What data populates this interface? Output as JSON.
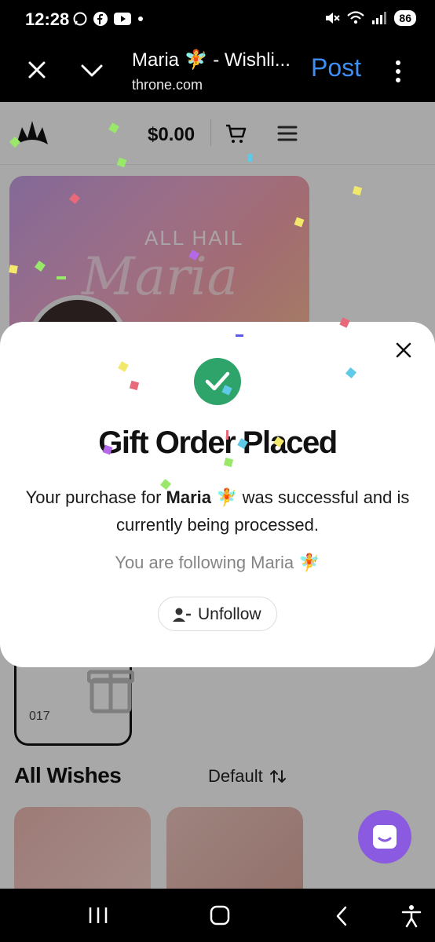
{
  "status_bar": {
    "time": "12:28",
    "battery": "86",
    "left_icons": [
      "chat-bubble-icon",
      "facebook-icon",
      "youtube-icon",
      "dot-icon"
    ],
    "right_icons": [
      "mute-icon",
      "wifi-icon",
      "signal-icon",
      "battery-icon"
    ]
  },
  "browser": {
    "title": "Maria 🧚 - Wishli...",
    "url": "throne.com",
    "post_label": "Post"
  },
  "header": {
    "cart_total": "$0.00"
  },
  "banner": {
    "tagline": "ALL HAIL",
    "name_script": "Maria"
  },
  "gift_card": {
    "number": "017"
  },
  "wishes": {
    "heading": "All Wishes",
    "sort_label": "Default"
  },
  "modal": {
    "title": "Gift Order Placed",
    "body_prefix": "Your purchase for ",
    "body_name": "Maria 🧚",
    "body_suffix": " was successful and is currently being processed.",
    "following_text": "You are following Maria 🧚",
    "unfollow_label": "Unfollow"
  },
  "colors": {
    "accent_post": "#3d8ff5",
    "success_green": "#2ea36a",
    "chat_purple": "#8a5ae0"
  }
}
